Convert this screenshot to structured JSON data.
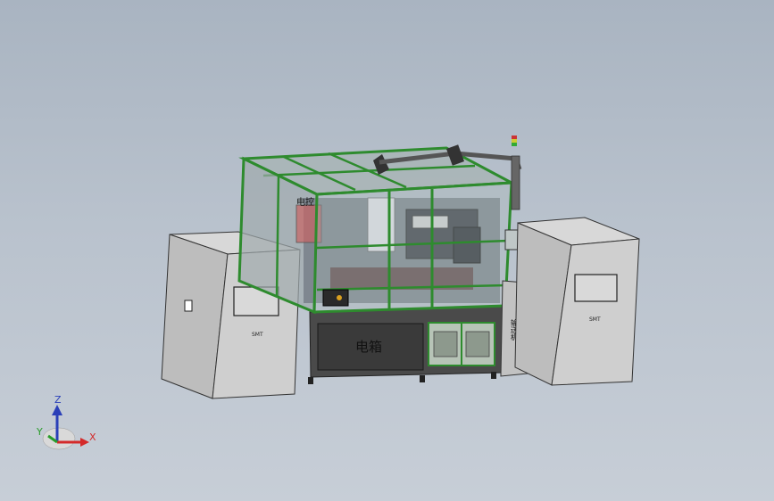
{
  "model": {
    "electrical_box_label": "电箱",
    "left_cabinet_label": "SMT",
    "right_cabinet_label": "SMT",
    "conveyor_label": "输送机",
    "control_panel_label": "电控"
  },
  "triad": {
    "x_label": "X",
    "y_label": "Y",
    "z_label": "Z",
    "colors": {
      "x": "#d42a2a",
      "y": "#2a9c2a",
      "z": "#2a3fb8"
    }
  },
  "colors": {
    "background_top": "#a9b4c1",
    "background_bottom": "#c7ced7",
    "frame_green": "#2e8b2e",
    "cabinet_grey": "#c9c9c9",
    "base_dark": "#3a3a3a"
  }
}
